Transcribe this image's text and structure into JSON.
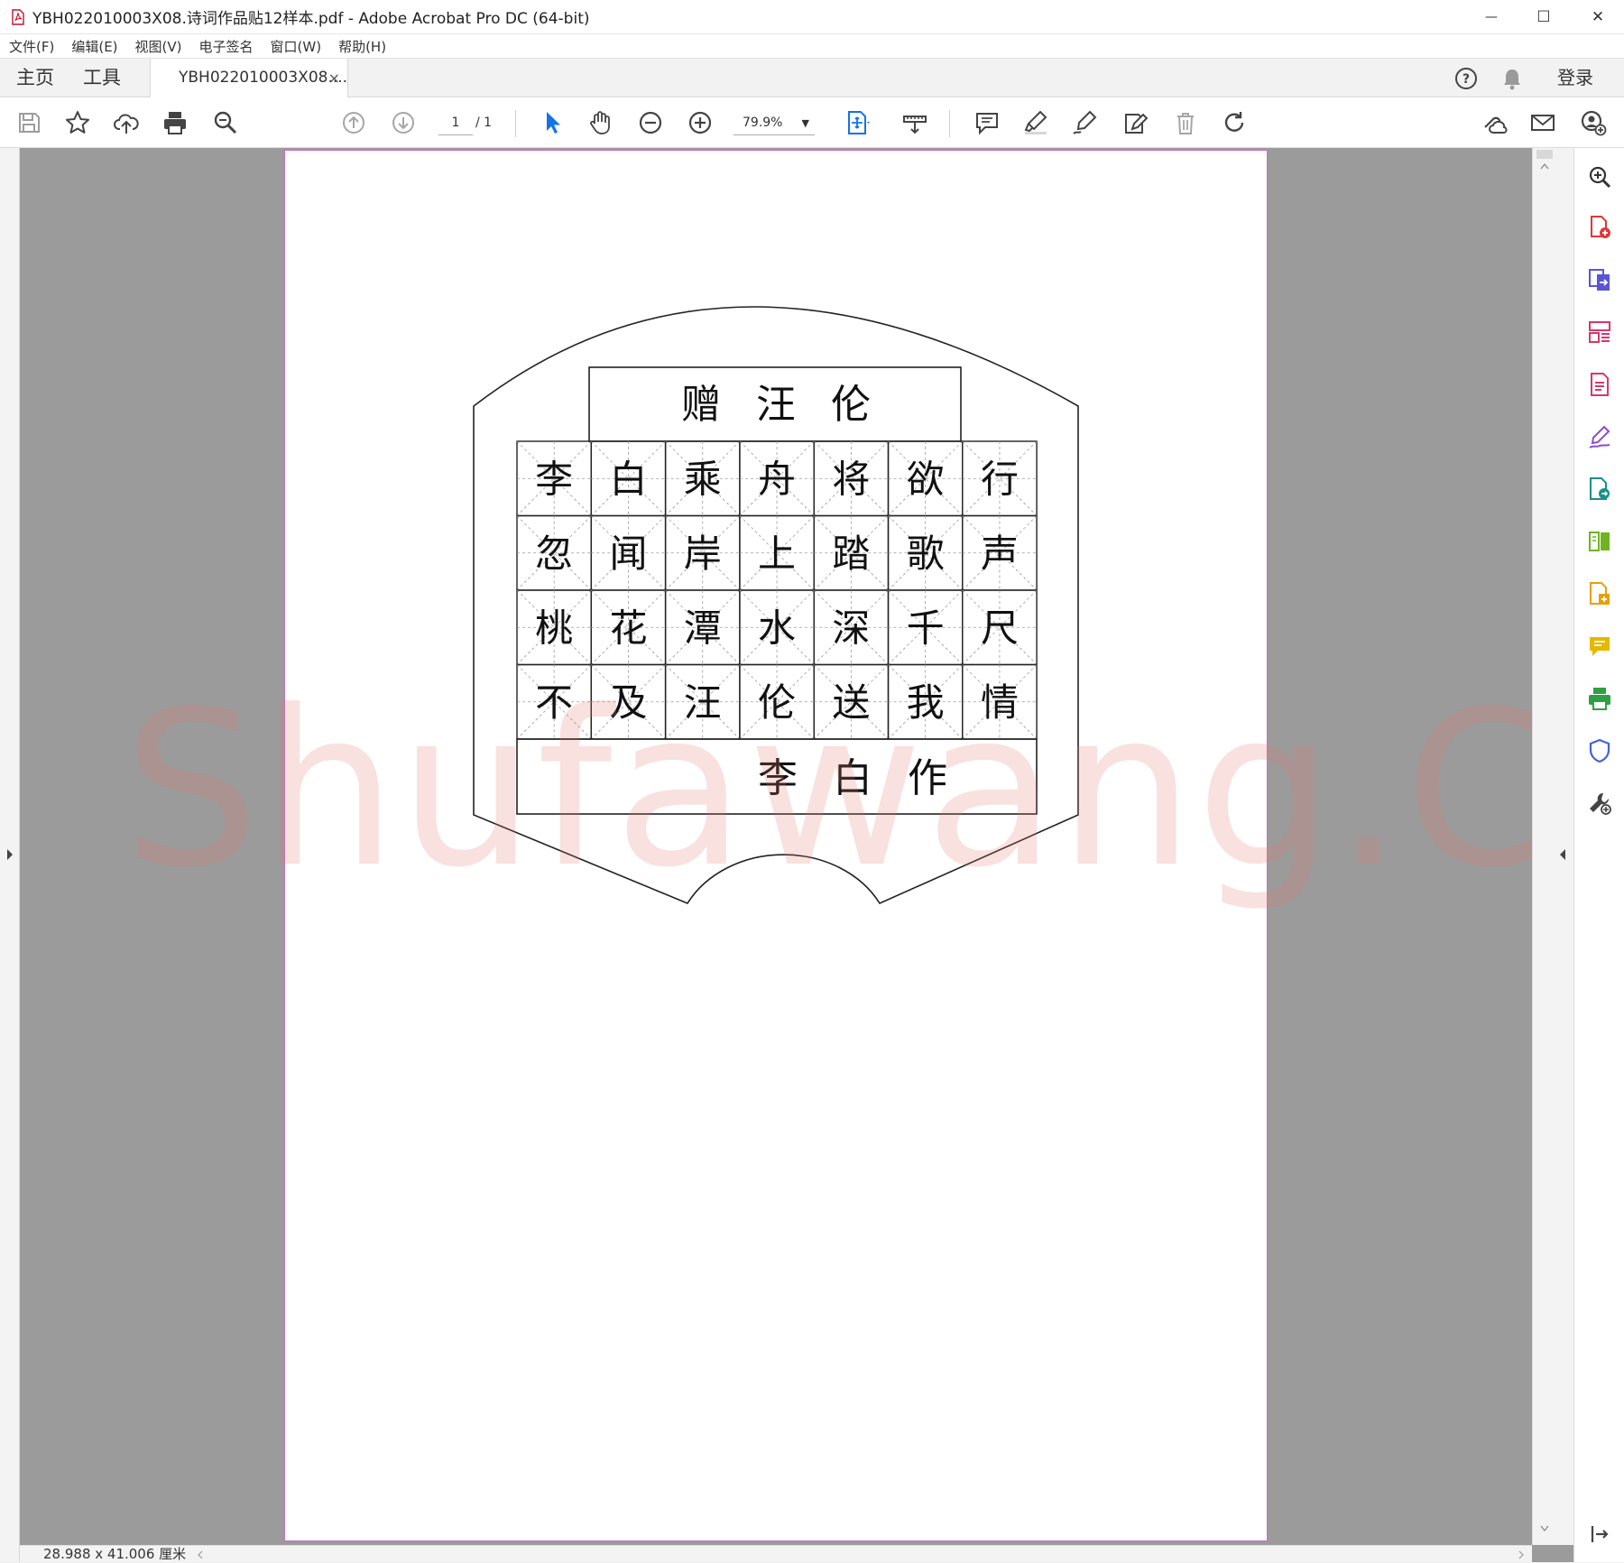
{
  "window": {
    "title": "YBH022010003X08.诗词作品贴12样本.pdf - Adobe Acrobat Pro DC (64-bit)",
    "minimize": "—",
    "maximize": "☐",
    "close": "✕"
  },
  "menu": [
    "文件(F)",
    "编辑(E)",
    "视图(V)",
    "电子签名",
    "窗口(W)",
    "帮助(H)"
  ],
  "tabs": {
    "home": "主页",
    "tools": "工具",
    "document": "YBH022010003X08....",
    "document_close": "×",
    "login": "登录"
  },
  "toolbar": {
    "page_current": "1",
    "page_total": "/ 1",
    "zoom": "79.9%",
    "zoom_arrow": "▼"
  },
  "document": {
    "poem_title": [
      "赠",
      "汪",
      "伦"
    ],
    "grid": [
      [
        "李",
        "白",
        "乘",
        "舟",
        "将",
        "欲",
        "行"
      ],
      [
        "忽",
        "闻",
        "岸",
        "上",
        "踏",
        "歌",
        "声"
      ],
      [
        "桃",
        "花",
        "潭",
        "水",
        "深",
        "千",
        "尺"
      ],
      [
        "不",
        "及",
        "汪",
        "伦",
        "送",
        "我",
        "情"
      ]
    ],
    "signature": [
      "李",
      "白",
      "作"
    ],
    "watermark": "Shufawang.CN"
  },
  "status": {
    "page_size": "28.988 x 41.006 厘米"
  },
  "colors": {
    "workarea": "#9b9b9b",
    "page_border": "#c76cc7",
    "accent_blue": "#1473e6",
    "watermark": "#e4786e"
  }
}
